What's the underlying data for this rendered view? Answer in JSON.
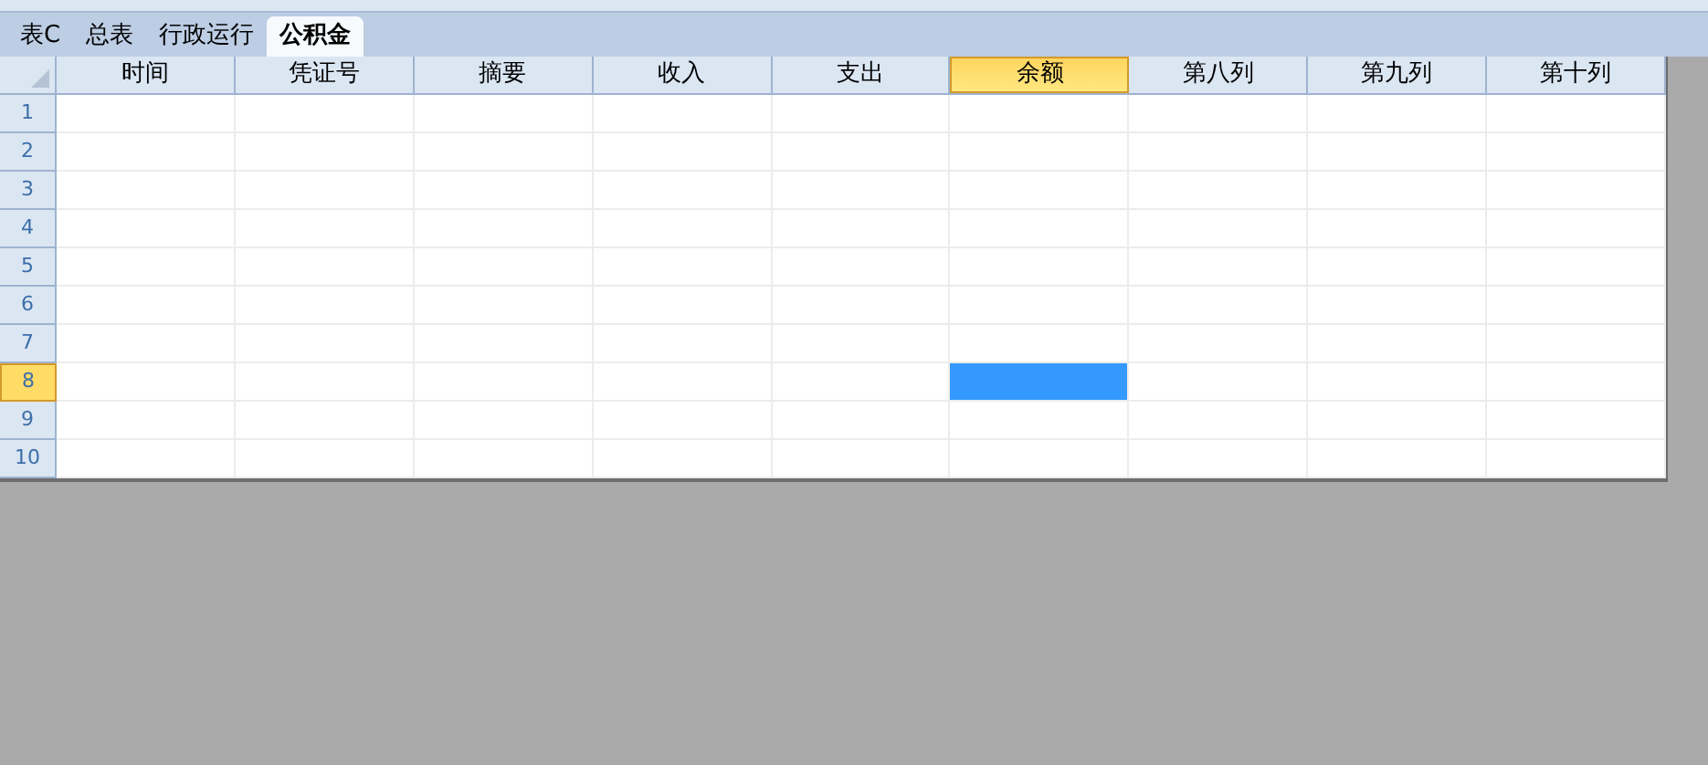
{
  "sheet_tabs": [
    {
      "label": "表C",
      "selected": false
    },
    {
      "label": "总表",
      "selected": false
    },
    {
      "label": "行政运行",
      "selected": false
    },
    {
      "label": "公积金",
      "selected": true
    }
  ],
  "columns": [
    {
      "label": "时间",
      "selected": false
    },
    {
      "label": "凭证号",
      "selected": false
    },
    {
      "label": "摘要",
      "selected": false
    },
    {
      "label": "收入",
      "selected": false
    },
    {
      "label": "支出",
      "selected": false
    },
    {
      "label": "余额",
      "selected": true
    },
    {
      "label": "第八列",
      "selected": false
    },
    {
      "label": "第九列",
      "selected": false
    },
    {
      "label": "第十列",
      "selected": false
    }
  ],
  "rows": [
    {
      "label": "1",
      "selected": false
    },
    {
      "label": "2",
      "selected": false
    },
    {
      "label": "3",
      "selected": false
    },
    {
      "label": "4",
      "selected": false
    },
    {
      "label": "5",
      "selected": false
    },
    {
      "label": "6",
      "selected": false
    },
    {
      "label": "7",
      "selected": false
    },
    {
      "label": "8",
      "selected": true
    },
    {
      "label": "9",
      "selected": false
    },
    {
      "label": "10",
      "selected": false
    }
  ]
}
